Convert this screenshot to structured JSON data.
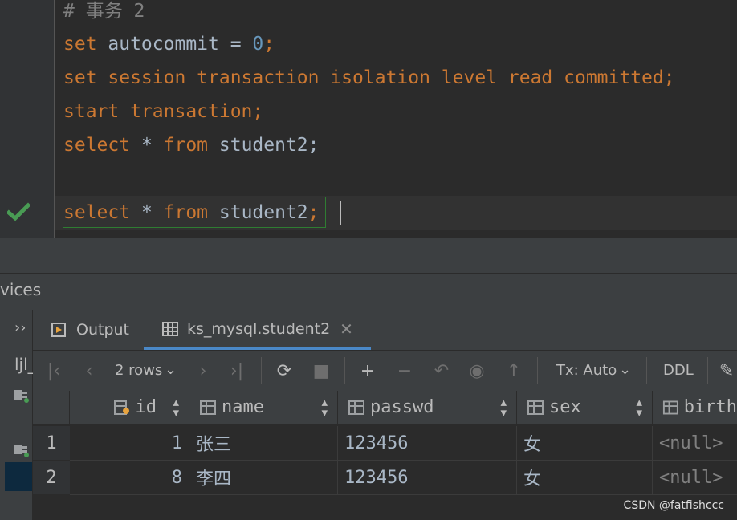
{
  "editor": {
    "comment": "# 事务 2",
    "lines": [
      {
        "kw1": "set",
        "text": " autocommit = ",
        "num": "0",
        "end": ";"
      },
      {
        "kw": "set session transaction isolation level read committed;"
      },
      {
        "kw": "start transaction;"
      },
      {
        "kw1": "select",
        "star": " * ",
        "kw2": "from",
        "rest": " student2;"
      },
      {
        "kw1": "select",
        "star": " * ",
        "kw2": "from",
        "rest": " student2",
        "end": ";"
      }
    ],
    "status_icon": "check-icon"
  },
  "services": {
    "title": "vices",
    "tree_label": "ljl_",
    "expand_icon": "chevron-double-right-icon"
  },
  "tabs": [
    {
      "label": "Output",
      "icon": "output-icon",
      "active": false
    },
    {
      "label": "ks_mysql.student2",
      "icon": "table-icon",
      "active": true,
      "close": "✕"
    }
  ],
  "toolbar": {
    "rows_label": "2 rows",
    "tx_label": "Tx: Auto",
    "ddl_label": "DDL",
    "icons": [
      "first-page-icon",
      "prev-page-icon",
      "next-page-icon",
      "last-page-icon",
      "refresh-icon",
      "stop-icon",
      "add-row-icon",
      "remove-row-icon",
      "revert-icon",
      "preview-icon",
      "submit-icon",
      "pin-icon"
    ]
  },
  "grid": {
    "columns": [
      "id",
      "name",
      "passwd",
      "sex",
      "birth"
    ],
    "rows": [
      {
        "num": "1",
        "cells": [
          "1",
          "张三",
          "123456",
          "女",
          "<null>"
        ]
      },
      {
        "num": "2",
        "cells": [
          "8",
          "李四",
          "123456",
          "女",
          "<null>"
        ]
      }
    ]
  },
  "watermark": "CSDN @fatfishccc",
  "colors": {
    "keyword": "#cc7832",
    "number": "#6897bb",
    "text": "#a9b7c6",
    "comment": "#808080",
    "bg": "#2b2b2b",
    "panel": "#3c3f41",
    "accent": "#4a88c7",
    "check": "#499c54"
  }
}
